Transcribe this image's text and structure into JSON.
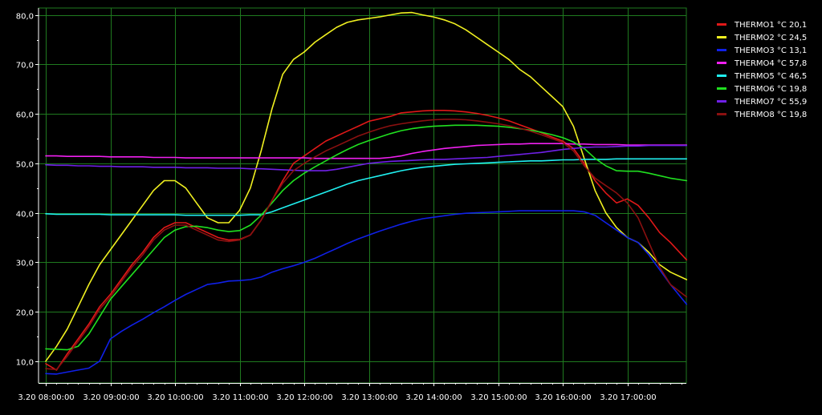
{
  "chart_data": {
    "type": "line",
    "x_start": "3.20 08:00:00",
    "x_end": "3.20 17:55:00",
    "ylim": [
      5.6,
      81.4
    ],
    "grid": true,
    "legend_position": "right",
    "x_tick_labels": [
      "3.20 08:00:00",
      "3.20 09:00:00",
      "3.20 10:00:00",
      "3.20 11:00:00",
      "3.20 12:00:00",
      "3.20 13:00:00",
      "3.20 14:00:00",
      "3.20 15:00:00",
      "3.20 16:00:00",
      "3.20 17:00:00"
    ],
    "y_ticks": [
      10,
      20,
      30,
      40,
      50,
      60,
      70,
      80
    ],
    "y_tick_labels": [
      "10,0",
      "20,0",
      "30,0",
      "40,0",
      "50,0",
      "60,0",
      "70,0",
      "80,0"
    ],
    "x": [
      "08:00",
      "08:10",
      "08:20",
      "08:30",
      "08:40",
      "08:50",
      "09:00",
      "09:10",
      "09:20",
      "09:30",
      "09:40",
      "09:50",
      "10:00",
      "10:10",
      "10:20",
      "10:30",
      "10:40",
      "10:50",
      "11:00",
      "11:10",
      "11:20",
      "11:30",
      "11:40",
      "11:50",
      "12:00",
      "12:10",
      "12:20",
      "12:30",
      "12:40",
      "12:50",
      "13:00",
      "13:10",
      "13:20",
      "13:30",
      "13:40",
      "13:50",
      "14:00",
      "14:10",
      "14:20",
      "14:30",
      "14:40",
      "14:50",
      "15:00",
      "15:10",
      "15:20",
      "15:30",
      "15:40",
      "15:50",
      "16:00",
      "16:10",
      "16:20",
      "16:30",
      "16:40",
      "16:50",
      "17:00",
      "17:10",
      "17:20",
      "17:30",
      "17:40",
      "17:55"
    ],
    "series": [
      {
        "name": "THERMO1 °C",
        "legend_value": "20,1",
        "color": "#e01818",
        "values": [
          9.5,
          8.2,
          11.5,
          14.5,
          17.5,
          21.0,
          23.5,
          26.5,
          29.5,
          32.0,
          35.0,
          37.0,
          38.0,
          38.0,
          37.0,
          36.0,
          35.0,
          34.5,
          34.6,
          35.5,
          38.5,
          42.5,
          46.5,
          50.0,
          51.5,
          53.0,
          54.5,
          55.5,
          56.5,
          57.5,
          58.5,
          59.0,
          59.5,
          60.2,
          60.4,
          60.6,
          60.7,
          60.7,
          60.6,
          60.4,
          60.1,
          59.7,
          59.2,
          58.6,
          57.8,
          57.0,
          56.2,
          55.3,
          54.5,
          53.0,
          50.0,
          46.5,
          44.0,
          42.0,
          42.8,
          41.5,
          39.0,
          36.0,
          34.0,
          30.5
        ]
      },
      {
        "name": "THERMO2 °C",
        "legend_value": "24,5",
        "color": "#f0f020",
        "values": [
          10.0,
          13.0,
          16.5,
          21.0,
          25.5,
          29.5,
          32.5,
          35.5,
          38.5,
          41.5,
          44.5,
          46.5,
          46.5,
          45.0,
          42.0,
          39.0,
          38.0,
          38.0,
          40.5,
          45.0,
          52.5,
          61.0,
          68.0,
          71.0,
          72.5,
          74.5,
          76.0,
          77.5,
          78.5,
          79.0,
          79.3,
          79.6,
          80.0,
          80.4,
          80.5,
          80.0,
          79.6,
          79.0,
          78.2,
          77.0,
          75.5,
          74.0,
          72.5,
          71.0,
          69.0,
          67.5,
          65.5,
          63.5,
          61.5,
          57.5,
          51.0,
          44.5,
          40.0,
          37.0,
          35.0,
          34.0,
          32.0,
          29.5,
          28.0,
          26.5
        ]
      },
      {
        "name": "THERMO3 °C",
        "legend_value": "13,1",
        "color": "#1020e8",
        "values": [
          7.5,
          7.4,
          7.8,
          8.2,
          8.6,
          10.0,
          14.5,
          16.0,
          17.3,
          18.5,
          19.8,
          21.0,
          22.3,
          23.5,
          24.5,
          25.5,
          25.8,
          26.2,
          26.3,
          26.5,
          27.0,
          28.0,
          28.7,
          29.3,
          30.0,
          30.8,
          31.8,
          32.8,
          33.8,
          34.7,
          35.5,
          36.3,
          37.0,
          37.7,
          38.3,
          38.8,
          39.1,
          39.4,
          39.7,
          39.9,
          40.0,
          40.1,
          40.2,
          40.3,
          40.4,
          40.4,
          40.4,
          40.4,
          40.4,
          40.4,
          40.2,
          39.5,
          38.0,
          36.5,
          35.0,
          34.0,
          31.5,
          28.5,
          25.5,
          21.5
        ]
      },
      {
        "name": "THERMO4 °C",
        "legend_value": "57,8",
        "color": "#f020f0",
        "values": [
          51.5,
          51.5,
          51.4,
          51.4,
          51.4,
          51.4,
          51.3,
          51.3,
          51.3,
          51.3,
          51.2,
          51.2,
          51.2,
          51.1,
          51.1,
          51.1,
          51.1,
          51.1,
          51.1,
          51.1,
          51.1,
          51.1,
          51.1,
          51.1,
          51.1,
          51.0,
          51.0,
          51.0,
          51.0,
          51.0,
          51.0,
          51.0,
          51.2,
          51.5,
          52.0,
          52.4,
          52.7,
          53.0,
          53.2,
          53.4,
          53.6,
          53.7,
          53.8,
          53.9,
          53.9,
          54.0,
          54.0,
          54.0,
          54.0,
          53.9,
          53.9,
          53.8,
          53.8,
          53.8,
          53.7,
          53.7,
          53.7,
          53.7,
          53.7,
          53.7
        ]
      },
      {
        "name": "THERMO5 °C",
        "legend_value": "46,5",
        "color": "#20f0f0",
        "values": [
          39.8,
          39.7,
          39.7,
          39.7,
          39.7,
          39.7,
          39.6,
          39.6,
          39.6,
          39.6,
          39.6,
          39.6,
          39.6,
          39.5,
          39.5,
          39.5,
          39.5,
          39.5,
          39.5,
          39.6,
          39.6,
          40.2,
          41.0,
          41.8,
          42.6,
          43.4,
          44.2,
          45.0,
          45.8,
          46.5,
          47.0,
          47.5,
          48.0,
          48.5,
          48.9,
          49.2,
          49.4,
          49.6,
          49.8,
          49.9,
          50.0,
          50.1,
          50.2,
          50.3,
          50.4,
          50.5,
          50.5,
          50.6,
          50.7,
          50.7,
          50.8,
          50.8,
          50.8,
          50.9,
          50.9,
          50.9,
          50.9,
          50.9,
          50.9,
          50.9
        ]
      },
      {
        "name": "THERMO6 °C",
        "legend_value": "19,8",
        "color": "#20e020",
        "values": [
          12.5,
          12.4,
          12.3,
          13.0,
          15.5,
          19.0,
          22.5,
          25.0,
          27.5,
          30.0,
          32.5,
          35.0,
          36.5,
          37.2,
          37.3,
          37.0,
          36.5,
          36.2,
          36.4,
          37.5,
          39.5,
          42.0,
          44.5,
          46.5,
          48.0,
          49.3,
          50.5,
          51.7,
          52.8,
          53.8,
          54.6,
          55.3,
          56.0,
          56.6,
          57.0,
          57.3,
          57.5,
          57.6,
          57.7,
          57.7,
          57.7,
          57.6,
          57.5,
          57.3,
          57.0,
          56.7,
          56.3,
          55.8,
          55.2,
          54.3,
          53.0,
          51.0,
          49.5,
          48.5,
          48.4,
          48.4,
          48.0,
          47.5,
          47.0,
          46.5
        ]
      },
      {
        "name": "THERMO7 °C",
        "legend_value": "55,9",
        "color": "#7020e8",
        "values": [
          49.7,
          49.6,
          49.6,
          49.5,
          49.5,
          49.4,
          49.4,
          49.3,
          49.3,
          49.3,
          49.2,
          49.2,
          49.2,
          49.1,
          49.1,
          49.1,
          49.0,
          49.0,
          49.0,
          48.9,
          48.9,
          48.8,
          48.7,
          48.6,
          48.5,
          48.5,
          48.5,
          48.8,
          49.2,
          49.6,
          50.0,
          50.2,
          50.4,
          50.5,
          50.6,
          50.7,
          50.8,
          50.8,
          50.9,
          51.0,
          51.1,
          51.2,
          51.4,
          51.6,
          51.8,
          52.0,
          52.2,
          52.5,
          52.8,
          53.0,
          53.2,
          53.3,
          53.3,
          53.4,
          53.5,
          53.5,
          53.6,
          53.6,
          53.6,
          53.6
        ]
      },
      {
        "name": "THERMO8 °C",
        "legend_value": "19,8",
        "color": "#8a1010",
        "values": [
          8.5,
          8.3,
          11.0,
          14.0,
          17.0,
          20.5,
          23.0,
          26.0,
          29.0,
          31.5,
          34.5,
          36.5,
          37.5,
          37.5,
          36.5,
          35.5,
          34.5,
          34.2,
          34.5,
          35.5,
          38.5,
          42.5,
          46.0,
          48.5,
          50.0,
          51.3,
          52.5,
          53.5,
          54.5,
          55.5,
          56.3,
          57.0,
          57.6,
          58.0,
          58.3,
          58.6,
          58.8,
          58.9,
          58.9,
          58.8,
          58.6,
          58.3,
          58.0,
          57.6,
          57.1,
          56.5,
          55.8,
          55.0,
          54.2,
          52.5,
          49.5,
          47.0,
          45.5,
          44.0,
          42.0,
          39.0,
          34.0,
          29.0,
          25.5,
          23.0
        ]
      }
    ]
  }
}
